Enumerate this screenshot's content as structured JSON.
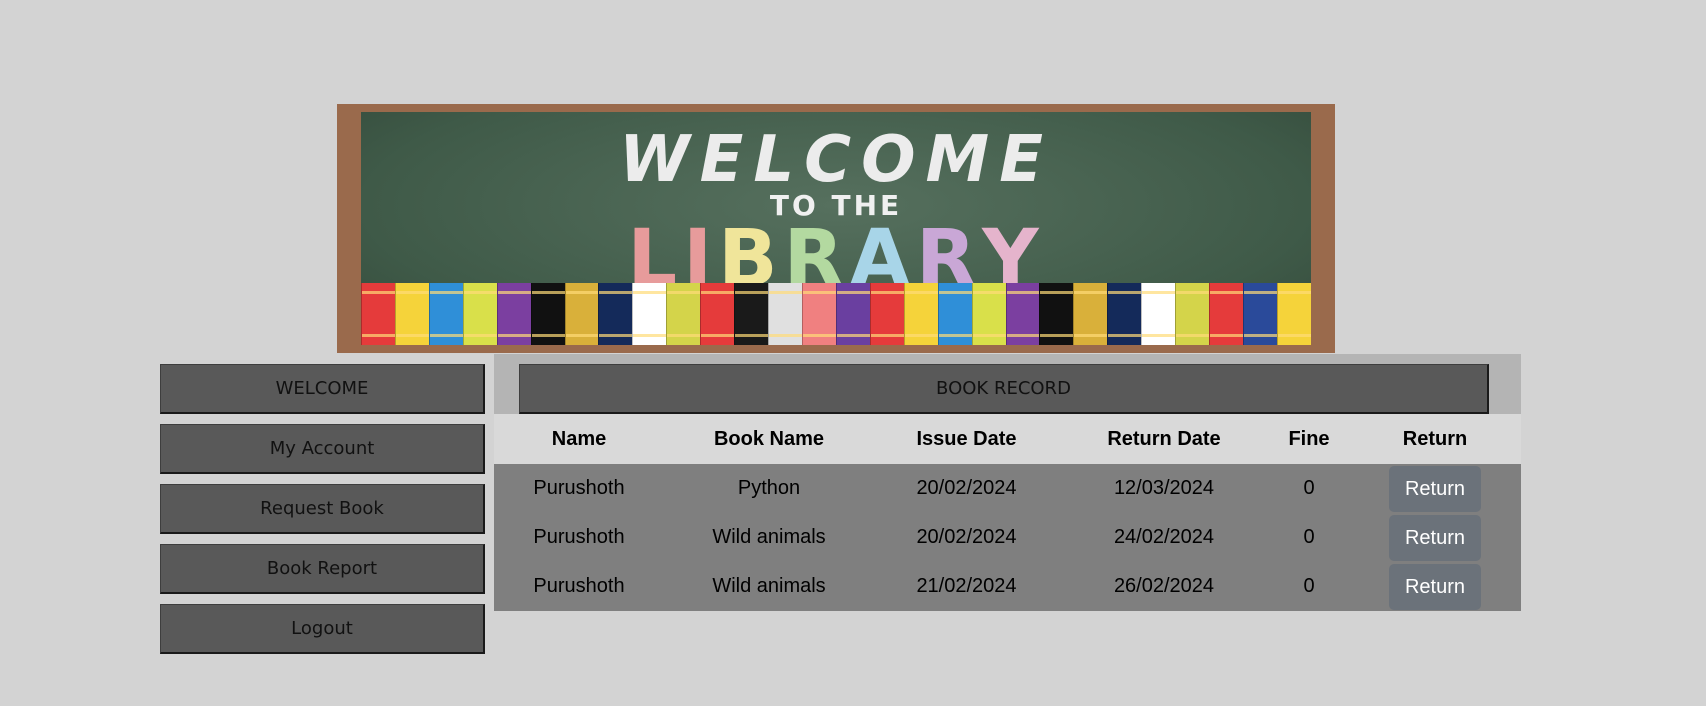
{
  "banner": {
    "line1": "WELCOME",
    "line2": "TO THE",
    "line3_letters": [
      "L",
      "I",
      "B",
      "R",
      "A",
      "R",
      "Y"
    ],
    "line3_colors": [
      "#e79b9b",
      "#e79b9b",
      "#f0e59a",
      "#b3d9a0",
      "#a8d5e8",
      "#c9a7d6",
      "#e5b4cc"
    ],
    "book_colors": [
      "#e53b3b",
      "#f5d33a",
      "#2f8fd8",
      "#d9e04a",
      "#7b3fa0",
      "#111111",
      "#d9b03a",
      "#142a5a",
      "#ffffff",
      "#d4d44a",
      "#e53b3b",
      "#1a1a1a",
      "#e0e0e0",
      "#f08080",
      "#6a3fa0",
      "#e53b3b",
      "#f5d33a",
      "#2f8fd8",
      "#d9e04a",
      "#7b3fa0",
      "#111111",
      "#d9b03a",
      "#142a5a",
      "#ffffff",
      "#d4d44a",
      "#e53b3b",
      "#2a4a9a",
      "#f5d33a"
    ]
  },
  "sidebar": {
    "items": [
      {
        "label": "WELCOME"
      },
      {
        "label": "My Account"
      },
      {
        "label": "Request Book"
      },
      {
        "label": "Book Report"
      },
      {
        "label": "Logout"
      }
    ]
  },
  "main": {
    "title": "BOOK RECORD",
    "table": {
      "headers": [
        "Name",
        "Book Name",
        "Issue Date",
        "Return Date",
        "Fine",
        "Return"
      ],
      "rows": [
        {
          "name": "Purushoth",
          "book": "Python",
          "issue": "20/02/2024",
          "return_date": "12/03/2024",
          "fine": "0",
          "action": "Return"
        },
        {
          "name": "Purushoth",
          "book": "Wild animals",
          "issue": "20/02/2024",
          "return_date": "24/02/2024",
          "fine": "0",
          "action": "Return"
        },
        {
          "name": "Purushoth",
          "book": "Wild animals",
          "issue": "21/02/2024",
          "return_date": "26/02/2024",
          "fine": "0",
          "action": "Return"
        }
      ]
    }
  }
}
